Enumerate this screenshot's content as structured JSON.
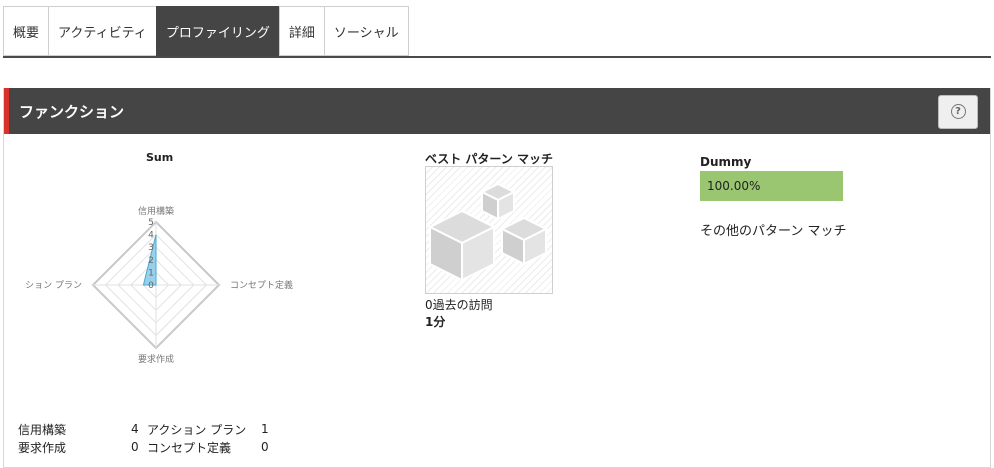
{
  "tabs": [
    {
      "label": "概要",
      "active": false
    },
    {
      "label": "アクティビティ",
      "active": false
    },
    {
      "label": "プロファイリング",
      "active": true
    },
    {
      "label": "詳細",
      "active": false
    },
    {
      "label": "ソーシャル",
      "active": false
    }
  ],
  "panel": {
    "title": "ファンクション",
    "help_icon": "question-circle-icon",
    "accent_color": "#d9322a"
  },
  "chart_data": {
    "type": "radar",
    "title": "Sum",
    "axes": [
      "信用構築",
      "コンセプト定義",
      "要求作成",
      "アクション プラン"
    ],
    "axis_labels_shown": [
      "信用構築",
      "コンセプト定義",
      "要求作成",
      "ション プラン"
    ],
    "ticks": [
      "0",
      "1",
      "2",
      "3",
      "4",
      "5"
    ],
    "range": [
      0,
      5
    ],
    "series": [
      {
        "values": [
          4,
          0,
          0,
          1
        ],
        "color": "#7fc6e6"
      }
    ]
  },
  "legend": [
    {
      "name": "信用構築",
      "value": "4",
      "name2": "アクション プラン",
      "value2": "1"
    },
    {
      "name": "要求作成",
      "value": "0",
      "name2": "コンセプト定義",
      "value2": "0"
    }
  ],
  "best_match": {
    "title": "ベスト パターン マッチ",
    "visits": "0過去の訪問",
    "duration": "1分"
  },
  "dummy": {
    "label": "Dummy",
    "percent_text": "100.00%",
    "percent": 100,
    "bar_color": "#9ac672"
  },
  "other_matches_label": "その他のパターン マッチ"
}
